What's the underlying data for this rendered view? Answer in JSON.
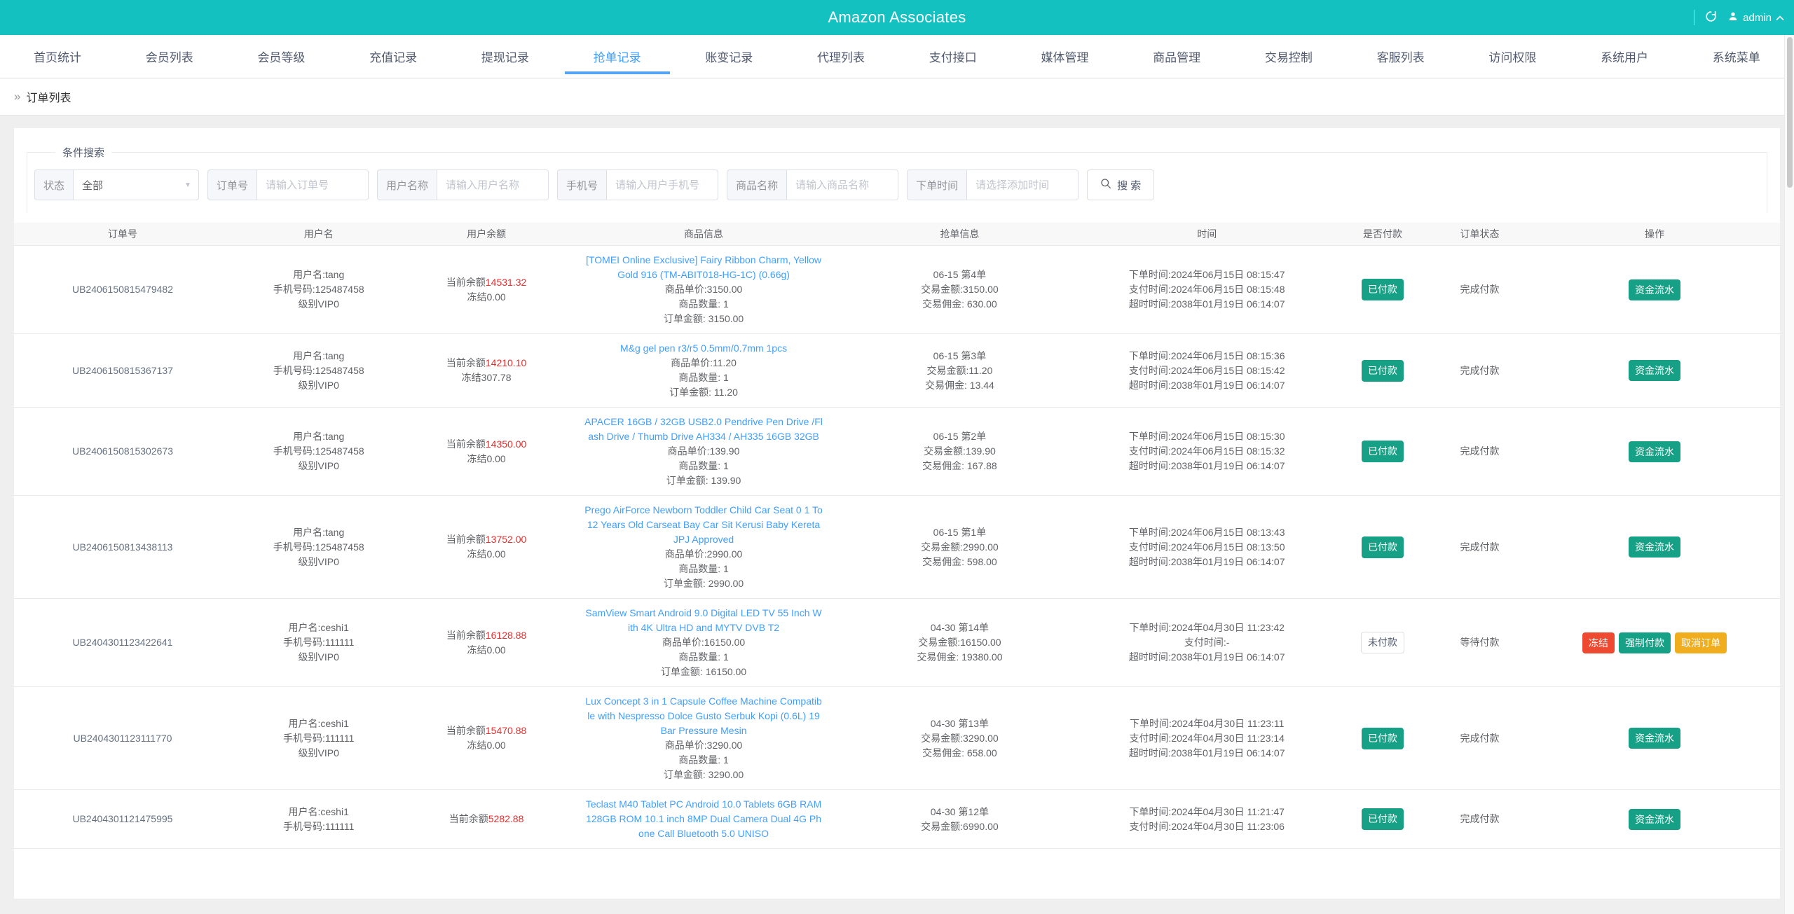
{
  "header": {
    "title": "Amazon Associates",
    "user": "admin"
  },
  "nav": {
    "tabs": [
      {
        "label": "首页统计",
        "active": false
      },
      {
        "label": "会员列表",
        "active": false
      },
      {
        "label": "会员等级",
        "active": false
      },
      {
        "label": "充值记录",
        "active": false
      },
      {
        "label": "提现记录",
        "active": false
      },
      {
        "label": "抢单记录",
        "active": true
      },
      {
        "label": "账变记录",
        "active": false
      },
      {
        "label": "代理列表",
        "active": false
      },
      {
        "label": "支付接口",
        "active": false
      },
      {
        "label": "媒体管理",
        "active": false
      },
      {
        "label": "商品管理",
        "active": false
      },
      {
        "label": "交易控制",
        "active": false
      },
      {
        "label": "客服列表",
        "active": false
      },
      {
        "label": "访问权限",
        "active": false
      },
      {
        "label": "系统用户",
        "active": false
      },
      {
        "label": "系统菜单",
        "active": false
      }
    ]
  },
  "breadcrumb": {
    "current": "订单列表"
  },
  "search": {
    "legend": "条件搜索",
    "status": {
      "label": "状态",
      "value": "全部"
    },
    "fields": [
      {
        "label": "订单号",
        "placeholder": "请输入订单号"
      },
      {
        "label": "用户名称",
        "placeholder": "请输入用户名称"
      },
      {
        "label": "手机号",
        "placeholder": "请输入用户手机号"
      },
      {
        "label": "商品名称",
        "placeholder": "请输入商品名称"
      },
      {
        "label": "下单时间",
        "placeholder": "请选择添加时间"
      }
    ],
    "button_label": "搜 索"
  },
  "table": {
    "columns": [
      "订单号",
      "用户名",
      "用户余额",
      "商品信息",
      "抢单信息",
      "时间",
      "是否付款",
      "订单状态",
      "操作"
    ],
    "rows": [
      {
        "order_no": "UB2406150815479482",
        "user": {
          "name": "用户名:tang",
          "phone": "手机号码:125487458",
          "level": "级别VIP0"
        },
        "balance": {
          "label": "当前余额",
          "amount": "14531.32",
          "frozen": "冻结0.00"
        },
        "product": {
          "title": "[TOMEI Online Exclusive] Fairy Ribbon Charm, Yellow Gold 916 (TM-ABIT018-HG-1C) (0.66g)",
          "info": [
            "商品单价:3150.00",
            "商品数量: 1",
            "订单金额: 3150.00"
          ]
        },
        "grab": [
          "06-15 第4单",
          "交易金额:3150.00",
          "交易佣金: 630.00"
        ],
        "time": [
          "下单时间:2024年06月15日 08:15:47",
          "支付时间:2024年06月15日 08:15:48",
          "超时时间:2038年01月19日 06:14:07"
        ],
        "paid": {
          "label": "已付款",
          "style": "teal"
        },
        "status": "完成付款",
        "actions": [
          {
            "label": "资金流水",
            "style": "teal"
          }
        ]
      },
      {
        "order_no": "UB2406150815367137",
        "user": {
          "name": "用户名:tang",
          "phone": "手机号码:125487458",
          "level": "级别VIP0"
        },
        "balance": {
          "label": "当前余额",
          "amount": "14210.10",
          "frozen": "冻结307.78"
        },
        "product": {
          "title": "M&g gel pen r3/r5 0.5mm/0.7mm 1pcs",
          "info": [
            "商品单价:11.20",
            "商品数量: 1",
            "订单金额: 11.20"
          ]
        },
        "grab": [
          "06-15 第3单",
          "交易金额:11.20",
          "交易佣金: 13.44"
        ],
        "time": [
          "下单时间:2024年06月15日 08:15:36",
          "支付时间:2024年06月15日 08:15:42",
          "超时时间:2038年01月19日 06:14:07"
        ],
        "paid": {
          "label": "已付款",
          "style": "teal"
        },
        "status": "完成付款",
        "actions": [
          {
            "label": "资金流水",
            "style": "teal"
          }
        ]
      },
      {
        "order_no": "UB2406150815302673",
        "user": {
          "name": "用户名:tang",
          "phone": "手机号码:125487458",
          "level": "级别VIP0"
        },
        "balance": {
          "label": "当前余额",
          "amount": "14350.00",
          "frozen": "冻结0.00"
        },
        "product": {
          "title": "APACER 16GB / 32GB USB2.0 Pendrive Pen Drive /Flash Drive / Thumb Drive AH334 / AH335 16GB 32GB",
          "info": [
            "商品单价:139.90",
            "商品数量: 1",
            "订单金额: 139.90"
          ]
        },
        "grab": [
          "06-15 第2单",
          "交易金额:139.90",
          "交易佣金: 167.88"
        ],
        "time": [
          "下单时间:2024年06月15日 08:15:30",
          "支付时间:2024年06月15日 08:15:32",
          "超时时间:2038年01月19日 06:14:07"
        ],
        "paid": {
          "label": "已付款",
          "style": "teal"
        },
        "status": "完成付款",
        "actions": [
          {
            "label": "资金流水",
            "style": "teal"
          }
        ]
      },
      {
        "order_no": "UB2406150813438113",
        "user": {
          "name": "用户名:tang",
          "phone": "手机号码:125487458",
          "level": "级别VIP0"
        },
        "balance": {
          "label": "当前余额",
          "amount": "13752.00",
          "frozen": "冻结0.00"
        },
        "product": {
          "title": "Prego AirForce Newborn Toddler Child Car Seat 0 1 To 12 Years Old Carseat Bay Car Sit Kerusi Baby Kereta JPJ Approved",
          "info": [
            "商品单价:2990.00",
            "商品数量: 1",
            "订单金额: 2990.00"
          ]
        },
        "grab": [
          "06-15 第1单",
          "交易金额:2990.00",
          "交易佣金: 598.00"
        ],
        "time": [
          "下单时间:2024年06月15日 08:13:43",
          "支付时间:2024年06月15日 08:13:50",
          "超时时间:2038年01月19日 06:14:07"
        ],
        "paid": {
          "label": "已付款",
          "style": "teal"
        },
        "status": "完成付款",
        "actions": [
          {
            "label": "资金流水",
            "style": "teal"
          }
        ]
      },
      {
        "order_no": "UB2404301123422641",
        "user": {
          "name": "用户名:ceshi1",
          "phone": "手机号码:111111",
          "level": "级别VIP0"
        },
        "balance": {
          "label": "当前余额",
          "amount": "16128.88",
          "frozen": "冻结0.00"
        },
        "product": {
          "title": "SamView Smart Android 9.0 Digital LED TV 55 Inch With 4K Ultra HD and MYTV DVB T2",
          "info": [
            "商品单价:16150.00",
            "商品数量: 1",
            "订单金额: 16150.00"
          ]
        },
        "grab": [
          "04-30 第14单",
          "交易金额:16150.00",
          "交易佣金: 19380.00"
        ],
        "time": [
          "下单时间:2024年04月30日 11:23:42",
          "支付时间:-",
          "超时时间:2038年01月19日 06:14:07"
        ],
        "paid": {
          "label": "未付款",
          "style": "plain"
        },
        "status": "等待付款",
        "actions": [
          {
            "label": "冻结",
            "style": "red"
          },
          {
            "label": "强制付款",
            "style": "teal"
          },
          {
            "label": "取消订单",
            "style": "amber"
          }
        ]
      },
      {
        "order_no": "UB2404301123111770",
        "user": {
          "name": "用户名:ceshi1",
          "phone": "手机号码:111111",
          "level": "级别VIP0"
        },
        "balance": {
          "label": "当前余额",
          "amount": "15470.88",
          "frozen": "冻结0.00"
        },
        "product": {
          "title": "Lux Concept 3 in 1 Capsule Coffee Machine Compatible with Nespresso Dolce Gusto Serbuk Kopi (0.6L) 19 Bar Pressure Mesin",
          "info": [
            "商品单价:3290.00",
            "商品数量: 1",
            "订单金额: 3290.00"
          ]
        },
        "grab": [
          "04-30 第13单",
          "交易金额:3290.00",
          "交易佣金: 658.00"
        ],
        "time": [
          "下单时间:2024年04月30日 11:23:11",
          "支付时间:2024年04月30日 11:23:14",
          "超时时间:2038年01月19日 06:14:07"
        ],
        "paid": {
          "label": "已付款",
          "style": "teal"
        },
        "status": "完成付款",
        "actions": [
          {
            "label": "资金流水",
            "style": "teal"
          }
        ]
      },
      {
        "order_no": "UB2404301121475995",
        "user": {
          "name": "用户名:ceshi1",
          "phone": "手机号码:111111",
          "level": ""
        },
        "balance": {
          "label": "当前余额",
          "amount": "5282.88",
          "frozen": ""
        },
        "product": {
          "title": "Teclast M40 Tablet PC Android 10.0 Tablets 6GB RAM 128GB ROM 10.1 inch 8MP Dual Camera Dual 4G Phone Call Bluetooth 5.0 UNISO",
          "info": []
        },
        "grab": [
          "04-30 第12单",
          "交易金额:6990.00"
        ],
        "time": [
          "下单时间:2024年04月30日 11:21:47",
          "支付时间:2024年04月30日 11:23:06"
        ],
        "paid": {
          "label": "已付款",
          "style": "teal"
        },
        "status": "完成付款",
        "actions": [
          {
            "label": "资金流水",
            "style": "teal"
          }
        ]
      }
    ]
  },
  "colors": {
    "topbar_teal": "#14c1c1",
    "active_tab_blue": "#409eff",
    "link_blue": "#409eff",
    "amount_red": "#e62e2e",
    "badge_teal": "#16a085",
    "badge_red": "#ee4a31",
    "badge_amber": "#f0ae1e"
  }
}
